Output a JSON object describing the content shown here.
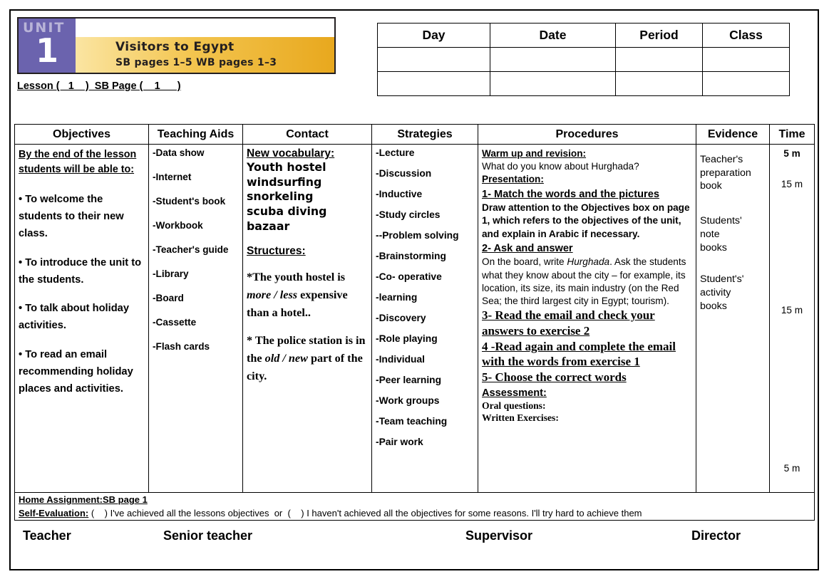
{
  "banner": {
    "unit_word": "UNIT",
    "unit_number": "1",
    "title": "Visitors to Egypt",
    "pages": "SB pages 1–5   WB pages 1–3",
    "badge_color": "#6b63ae",
    "strip_color": "#e8a81e"
  },
  "lesson_line": "Lesson (   1    )  SB Page (    1      )",
  "info_table": {
    "headers": [
      "Day",
      "Date",
      "Period",
      "Class"
    ],
    "rows": [
      [
        "",
        "",
        "",
        ""
      ],
      [
        "",
        "",
        "",
        ""
      ]
    ]
  },
  "grid": {
    "headers": [
      "Objectives",
      "Teaching Aids",
      "Contact",
      "Strategies",
      "Procedures",
      "Evidence",
      "Time"
    ]
  },
  "objectives": {
    "heading": "By the end of the lesson students will be able to:",
    "items": [
      "• To welcome the students to their new class.",
      "• To introduce the unit to the students.",
      "• To talk about holiday activities.",
      "• To read an email recommending holiday places and activities."
    ]
  },
  "teaching_aids": {
    "items": [
      "-Data show",
      "-Internet",
      "-Student's book",
      "-Workbook",
      "-Teacher's guide",
      "-Library",
      "-Board",
      "-Cassette",
      "-Flash cards"
    ]
  },
  "contact": {
    "vocab_heading": "New vocabulary",
    "vocab_heading_colon": ":",
    "vocab": [
      "Youth hostel",
      "windsurfing",
      "snorkeling",
      "scuba diving",
      "bazaar"
    ],
    "structures_heading": "Structures:",
    "structure_1_a": "*The youth hostel is ",
    "structure_1_em": "more / less",
    "structure_1_b": " expensive than a hotel..",
    "structure_2_a": "* The police station is in the ",
    "structure_2_em": "old / new",
    "structure_2_b": " part of the city."
  },
  "strategies": {
    "items": [
      "-Lecture",
      "-Discussion",
      "-Inductive",
      "-Study circles",
      "--Problem solving",
      "-Brainstorming",
      "-Co- operative",
      "-learning",
      "-Discovery",
      "-Role playing",
      "-Individual",
      "-Peer learning",
      "-Work groups",
      "-Team teaching",
      "-Pair work"
    ]
  },
  "procedures": {
    "warmup_heading": "Warm up and revision:",
    "warmup_text": "What do you know about Hurghada?",
    "presentation_heading": "Presentation:",
    "step1_heading": "1- Match the words and the pictures",
    "step1_body": "Draw attention to the Objectives box on page 1, which refers to the objectives of the unit, and explain in Arabic if necessary.",
    "step2_heading": "2- Ask and answer ",
    "step2_a": "On the board, write ",
    "step2_em": "Hurghada",
    "step2_b": ". Ask the students what they know about the city – for example, its location, its size, its main industry (on the Red Sea; the third largest city in Egypt; tourism).",
    "step3_heading": "3- Read the email and check your answers to exercise 2",
    "step4_heading": "4 -Read again and complete the email with the words from exercise 1",
    "step5_heading": "5- Choose the correct words",
    "assessment_heading": "Assessment:",
    "assessment_oral": "Oral questions:",
    "assessment_written": "Written Exercises",
    "assessment_written_colon": ":"
  },
  "evidence": {
    "items": [
      "Teacher's\n preparation\nbook",
      "Students'\nnote\nbooks",
      "Student's'\nactivity\nbooks"
    ]
  },
  "time": {
    "values": [
      "5 m",
      "15 m",
      "15 m",
      "5 m"
    ]
  },
  "footer": {
    "home_assignment": "Home Assignment:SB page 1",
    "self_eval_label": "Self-Evaluation:",
    "self_eval_text": " (    ) I've achieved all the lessons objectives  or  (    ) I haven't achieved all the objectives for some reasons. I'll try hard to achieve them"
  },
  "signatures": [
    "Teacher",
    "Senior teacher",
    "Supervisor",
    "Director"
  ]
}
